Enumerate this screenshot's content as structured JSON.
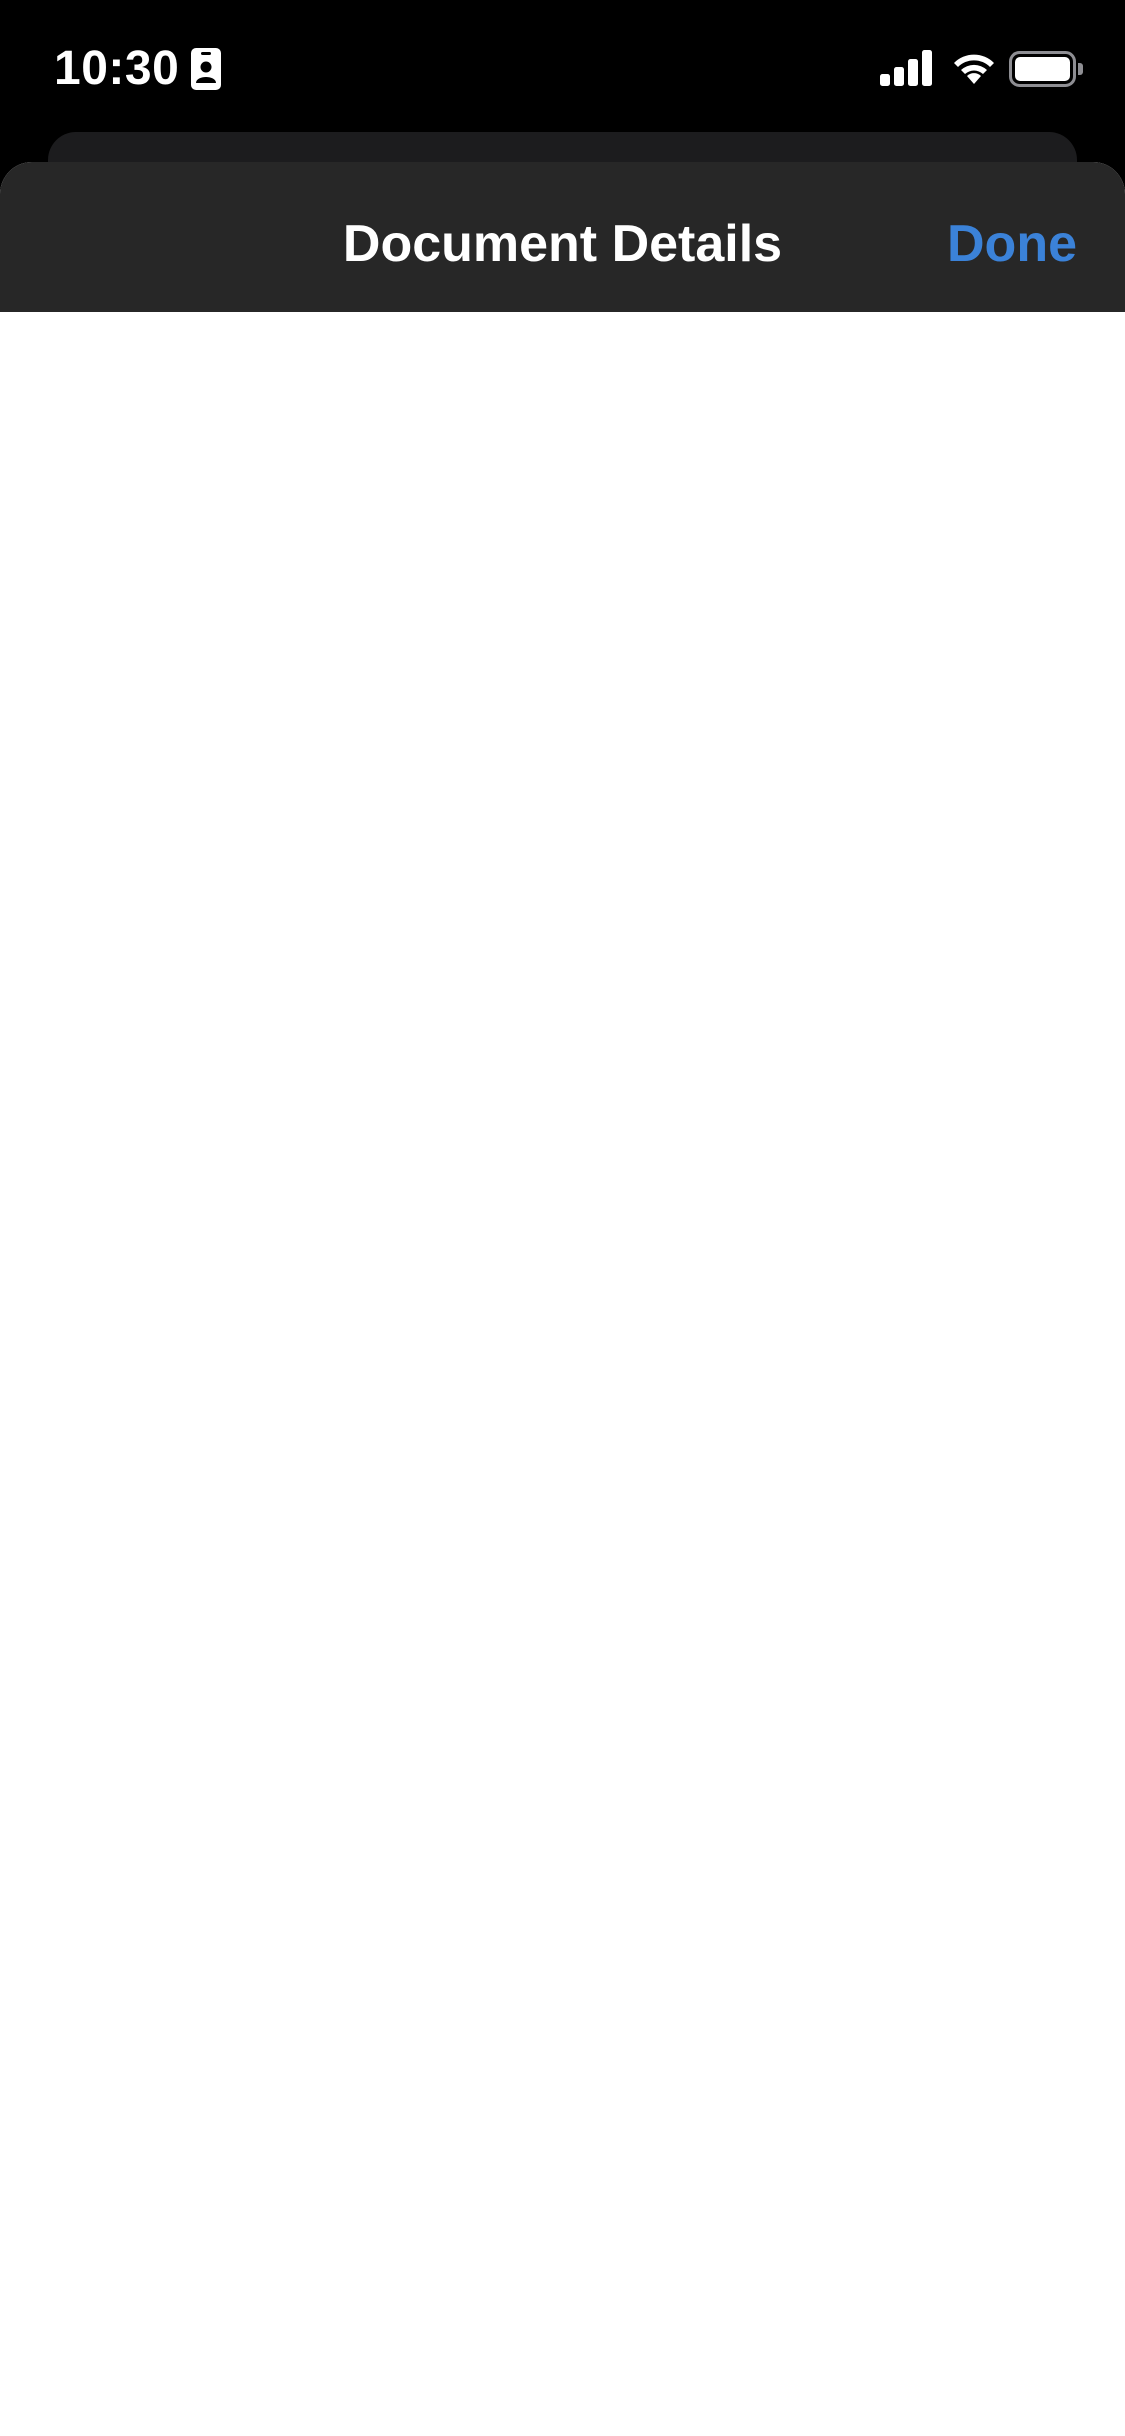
{
  "status_bar": {
    "time": "10:30",
    "icons": [
      "contact-card-icon",
      "signal-icon",
      "wifi-icon",
      "battery-icon"
    ]
  },
  "sheet": {
    "title": "Document Details",
    "done_label": "Done"
  },
  "colors": {
    "accent": "#3b82d8",
    "nav_background": "#272727",
    "content_background": "#ffffff",
    "status_background": "#000000"
  }
}
